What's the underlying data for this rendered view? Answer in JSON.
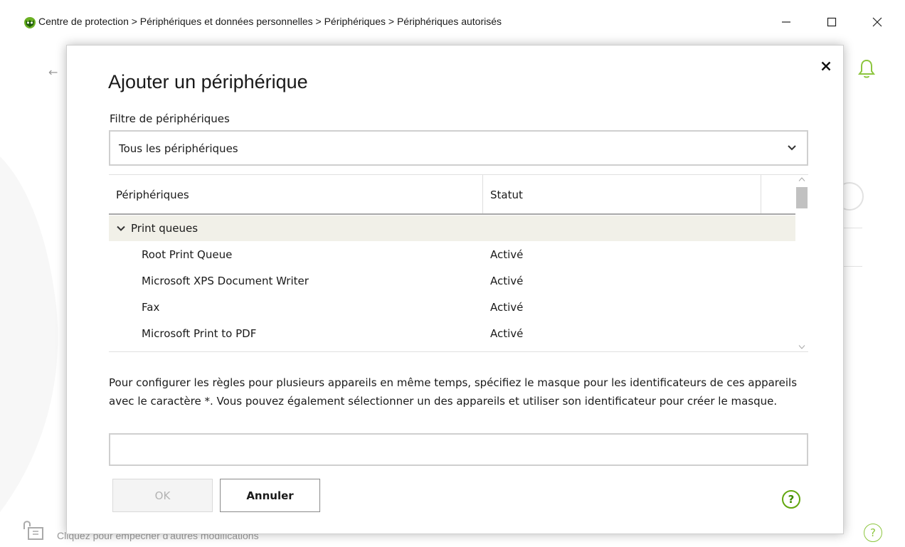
{
  "window": {
    "title": "Centre de protection > Périphériques et données personnelles > Périphériques > Périphériques autorisés",
    "minimize_icon": "minimize-icon",
    "maximize_icon": "maximize-icon",
    "close_icon": "close-icon"
  },
  "background": {
    "lock_text": "Cliquez pour empêcher d'autres modifications",
    "help_label": "?",
    "accent_color": "#8dc63f"
  },
  "dialog": {
    "title": "Ajouter un périphérique",
    "filter": {
      "label": "Filtre de périphériques",
      "selected": "Tous les périphériques"
    },
    "table": {
      "columns": [
        "Périphériques",
        "Statut"
      ],
      "groups": [
        {
          "label": "Print queues",
          "expanded": true,
          "rows": [
            {
              "name": "Root Print Queue",
              "status": "Activé"
            },
            {
              "name": "Microsoft XPS Document Writer",
              "status": "Activé"
            },
            {
              "name": "Fax",
              "status": "Activé"
            },
            {
              "name": "Microsoft Print to PDF",
              "status": "Activé"
            }
          ]
        }
      ]
    },
    "description": "Pour configurer les règles pour plusieurs appareils en même temps, spécifiez le masque pour les identificateurs de ces appareils avec le caractère *. Vous pouvez également sélectionner un des appareils et utiliser son identificateur pour créer le masque.",
    "mask_input": {
      "value": "",
      "placeholder": ""
    },
    "buttons": {
      "ok": "OK",
      "cancel": "Annuler"
    },
    "help_label": "?"
  }
}
